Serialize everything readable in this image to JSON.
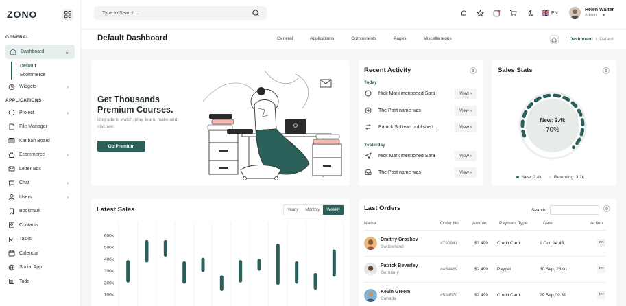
{
  "app": {
    "logo": "ZONO"
  },
  "sidebar": {
    "general_title": "GENERAL",
    "applications_title": "APPLICATIONS",
    "dashboard": "Dashboard",
    "sub_items": [
      "Default",
      "Ecommerce"
    ],
    "widgets": "Widgets",
    "apps": [
      "Project",
      "File Manager",
      "Kanban Board",
      "Ecommerce",
      "Letter Box",
      "Chat",
      "Users",
      "Bookmark",
      "Contacts",
      "Tasks",
      "Calendar",
      "Social App",
      "Todo"
    ]
  },
  "topbar": {
    "search_placeholder": "Type to Search ..",
    "language": "EN",
    "user_name": "Helen Walter",
    "user_role": "Admin"
  },
  "header": {
    "title": "Default Dashboard",
    "menu": [
      "General",
      "Applications",
      "Components",
      "Pages",
      "Miscellaneous"
    ],
    "breadcrumb": [
      "Dashboard",
      "Default"
    ]
  },
  "courses": {
    "title": "Get Thousands Premium Courses.",
    "subtitle": "Upgrade to watch, play, learn, make and discover.",
    "button": "Go Premium"
  },
  "recent_activity": {
    "title": "Recent Activity",
    "today_label": "Today",
    "yesterday_label": "Yesterday",
    "view_label": "View",
    "today": [
      {
        "text": "Nick Mark mentioned Sara",
        "icon": "message-icon"
      },
      {
        "text": "The Post name was",
        "icon": "download-icon"
      },
      {
        "text": "Patrick Sullivan published...",
        "icon": "exchange-icon"
      }
    ],
    "yesterday": [
      {
        "text": "Nick Mark mentioned Sara",
        "icon": "send-icon"
      },
      {
        "text": "The Post name was",
        "icon": "inbox-icon"
      }
    ]
  },
  "sales_stats": {
    "title": "Sales Stats",
    "center_label": "New: 2.4k",
    "percent": "70%",
    "percent_value": 70,
    "legend": [
      {
        "label": "New: 2.4k",
        "color": "#2b5f59"
      },
      {
        "label": "Returning: 3.2k",
        "color": "#e5e7ea"
      }
    ]
  },
  "latest_sales": {
    "title": "Latest Sales",
    "tabs": [
      "Yearly",
      "Monthly",
      "Weekly"
    ],
    "active_tab": "Weekly"
  },
  "chart_data": {
    "type": "bar",
    "title": "Latest Sales",
    "y_ticks": [
      "600k",
      "500k",
      "400k",
      "300k",
      "200k",
      "100k"
    ],
    "ylim": [
      100,
      650
    ],
    "values": [
      [
        200,
        390
      ],
      [
        370,
        560
      ],
      [
        420,
        560
      ],
      [
        190,
        380
      ],
      [
        290,
        410
      ],
      [
        130,
        260
      ],
      [
        200,
        390
      ],
      [
        300,
        400
      ],
      [
        180,
        530
      ],
      [
        190,
        380
      ],
      [
        140,
        280
      ],
      [
        250,
        480
      ]
    ],
    "grid": true,
    "color": "#2b5f59"
  },
  "last_orders": {
    "title": "Last Orders",
    "search_label": "Search:",
    "columns": [
      "Name",
      "Order No.",
      "Amount",
      "Payment Type",
      "Date",
      "Action"
    ],
    "rows": [
      {
        "name": "Dmitriy Groshev",
        "country": "Switzerland",
        "order": "#790841",
        "amount": "$2.499",
        "payment": "Credit Card",
        "date": "1 Oct, 14:43"
      },
      {
        "name": "Patrick Beverley",
        "country": "Germany",
        "order": "#454489",
        "amount": "$2.499",
        "payment": "Paypal",
        "date": "30 Sep, 23:01"
      },
      {
        "name": "Kevin Greem",
        "country": "Canada",
        "order": "#594579",
        "amount": "$2.499",
        "payment": "Credit Card",
        "date": "29 Sep,09:31"
      }
    ]
  }
}
